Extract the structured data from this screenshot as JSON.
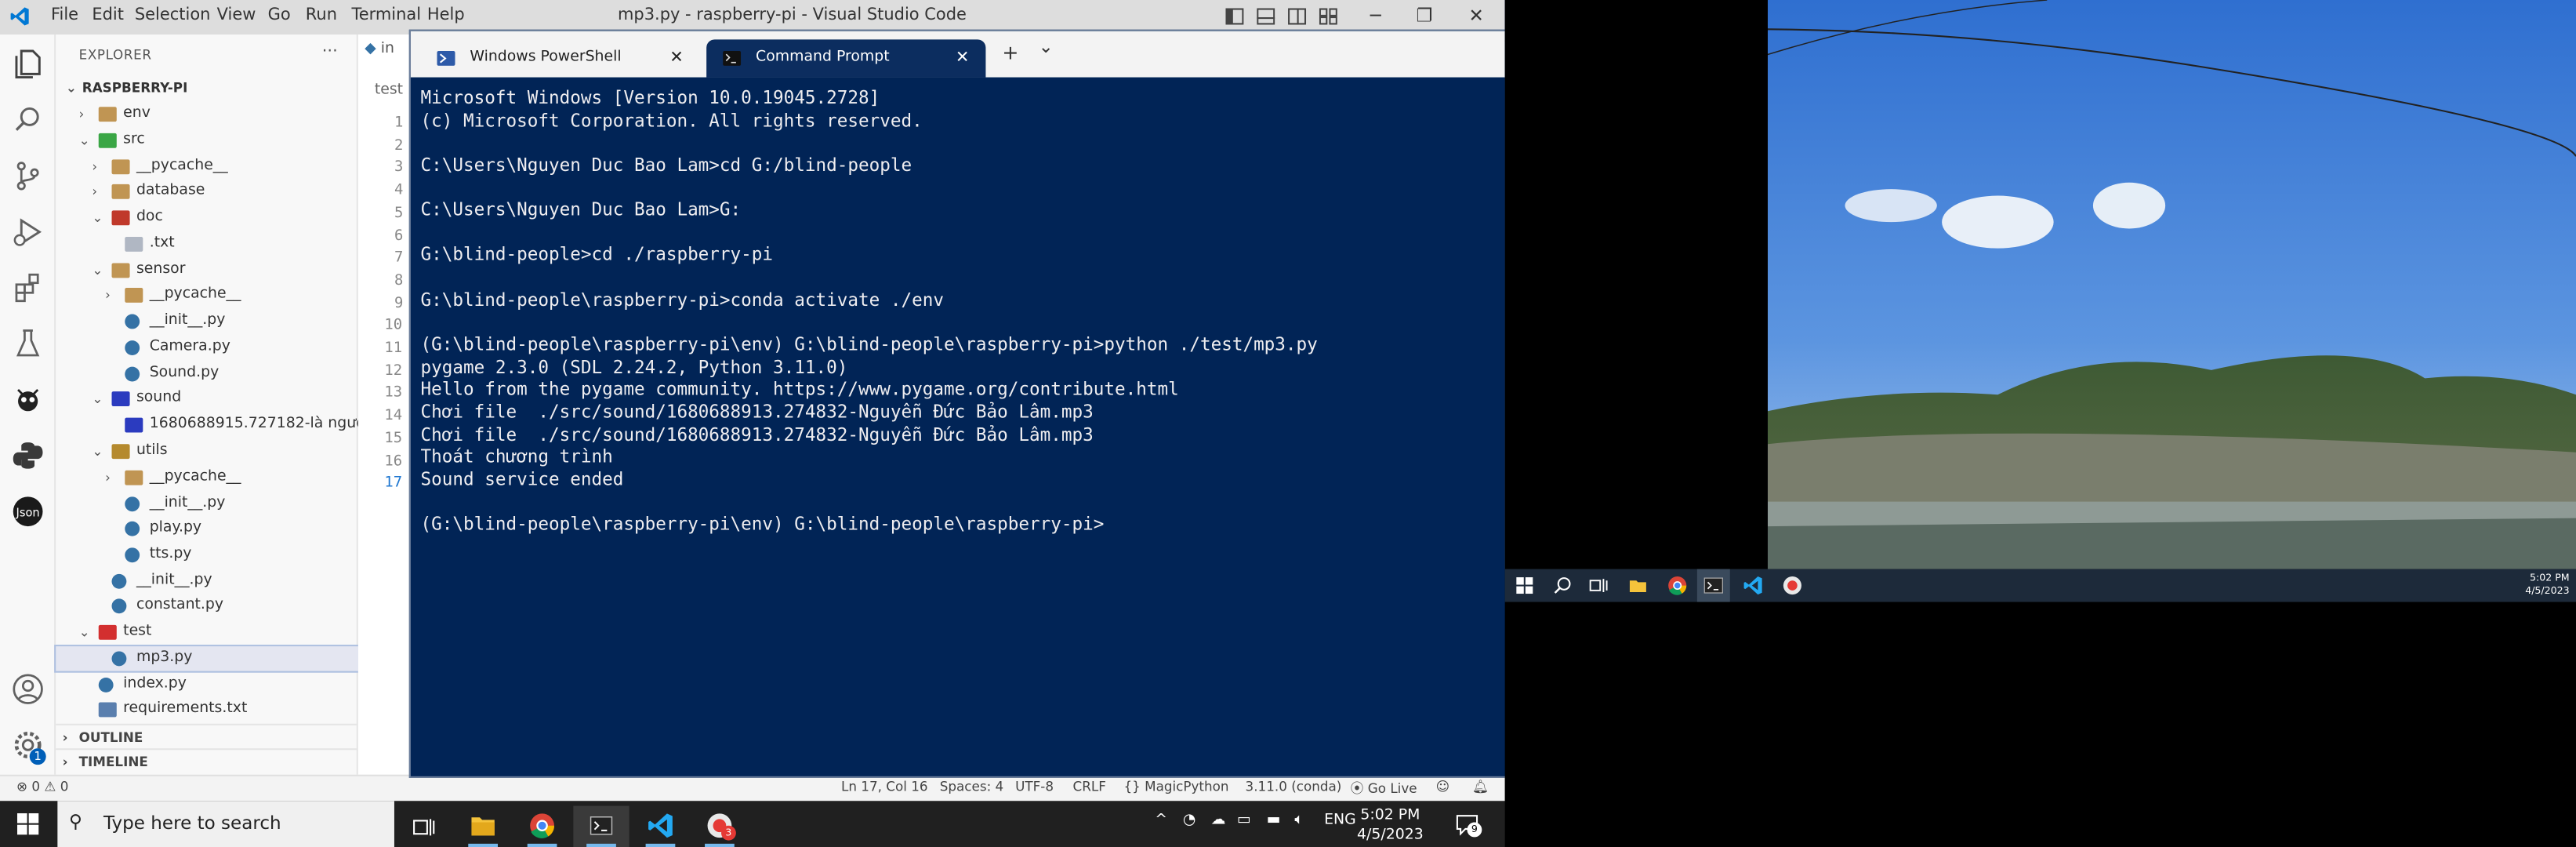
{
  "vscode": {
    "menu": [
      "File",
      "Edit",
      "Selection",
      "View",
      "Go",
      "Run",
      "Terminal",
      "Help"
    ],
    "window_title": "mp3.py - raspberry-pi - Visual Studio Code",
    "explorer_header": "EXPLORER",
    "explorer_more": "···",
    "tree": [
      {
        "label": "RASPBERRY-PI",
        "kind": "root"
      },
      {
        "label": "env",
        "kind": "folder"
      },
      {
        "label": "src",
        "kind": "folder-open"
      },
      {
        "label": "__pycache__",
        "kind": "folder"
      },
      {
        "label": "database",
        "kind": "folder"
      },
      {
        "label": "doc",
        "kind": "folder-open"
      },
      {
        "label": ".txt",
        "kind": "file"
      },
      {
        "label": "sensor",
        "kind": "folder-open"
      },
      {
        "label": "__pycache__",
        "kind": "folder"
      },
      {
        "label": "__init__.py",
        "kind": "py"
      },
      {
        "label": "Camera.py",
        "kind": "py"
      },
      {
        "label": "Sound.py",
        "kind": "py"
      },
      {
        "label": "sound",
        "kind": "folder-open"
      },
      {
        "label": "1680688915.727182-là người ...",
        "kind": "audio"
      },
      {
        "label": "utils",
        "kind": "folder-open"
      },
      {
        "label": "__pycache__",
        "kind": "folder"
      },
      {
        "label": "__init__.py",
        "kind": "py"
      },
      {
        "label": "play.py",
        "kind": "py"
      },
      {
        "label": "tts.py",
        "kind": "py"
      },
      {
        "label": "__init__.py",
        "kind": "py"
      },
      {
        "label": "constant.py",
        "kind": "py"
      },
      {
        "label": "test",
        "kind": "folder-open"
      },
      {
        "label": "mp3.py",
        "kind": "py"
      },
      {
        "label": "index.py",
        "kind": "py"
      },
      {
        "label": "requirements.txt",
        "kind": "txt"
      }
    ],
    "outline": "OUTLINE",
    "timeline": "TIMELINE",
    "editor_tab": "in",
    "breadcrumb": "test",
    "line_numbers": [
      "1",
      "2",
      "3",
      "4",
      "5",
      "6",
      "7",
      "8",
      "9",
      "10",
      "11",
      "12",
      "13",
      "14",
      "15",
      "16",
      "17"
    ],
    "status": {
      "problems": "⊗ 0 ⚠ 0",
      "position": "Ln 17, Col 16",
      "spaces": "Spaces: 4",
      "encoding": "UTF-8",
      "eol": "CRLF",
      "language": "{} MagicPython",
      "interpreter": "3.11.0 (conda)",
      "golive": "⦿ Go Live"
    },
    "badge": "1"
  },
  "terminal": {
    "tabs": [
      {
        "label": "Windows PowerShell",
        "active": false
      },
      {
        "label": "Command Prompt",
        "active": true
      }
    ],
    "new_tab": "+",
    "dropdown": "⌄",
    "lines": [
      "Microsoft Windows [Version 10.0.19045.2728]",
      "(c) Microsoft Corporation. All rights reserved.",
      "",
      "C:\\Users\\Nguyen Duc Bao Lam>cd G:/blind-people",
      "",
      "C:\\Users\\Nguyen Duc Bao Lam>G:",
      "",
      "G:\\blind-people>cd ./raspberry-pi",
      "",
      "G:\\blind-people\\raspberry-pi>conda activate ./env",
      "",
      "(G:\\blind-people\\raspberry-pi\\env) G:\\blind-people\\raspberry-pi>python ./test/mp3.py",
      "pygame 2.3.0 (SDL 2.24.2, Python 3.11.0)",
      "Hello from the pygame community. https://www.pygame.org/contribute.html",
      "Chơi file  ./src/sound/1680688913.274832-Nguyễn Đức Bảo Lâm.mp3",
      "Chơi file  ./src/sound/1680688913.274832-Nguyễn Đức Bảo Lâm.mp3",
      "Thoát chương trình",
      "Sound service ended",
      "",
      "(G:\\blind-people\\raspberry-pi\\env) G:\\blind-people\\raspberry-pi>"
    ]
  },
  "taskbar": {
    "search_placeholder": "Type here to search",
    "tray_lang": "ENG",
    "time": "5:02 PM",
    "date": "4/5/2023",
    "notif_count": "9",
    "app_badge": "3"
  },
  "right_monitor": {
    "time": "5:02 PM",
    "date": "4/5/2023"
  }
}
